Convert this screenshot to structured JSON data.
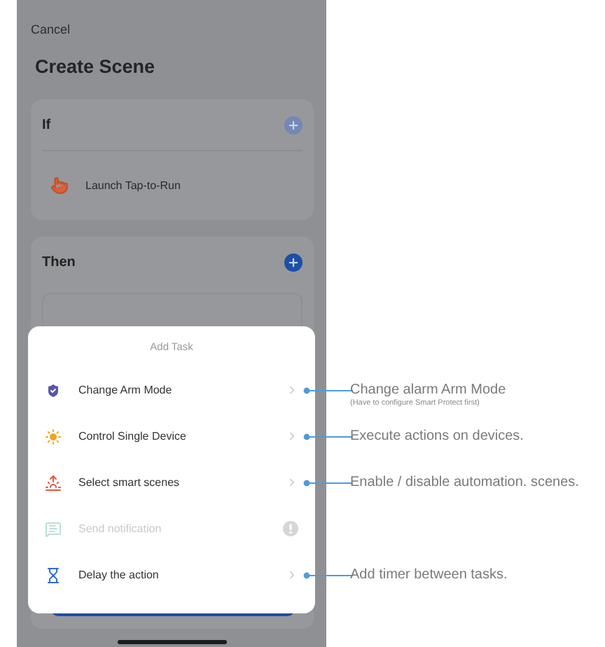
{
  "header": {
    "cancel": "Cancel",
    "title": "Create Scene"
  },
  "if_card": {
    "title": "If",
    "condition": "Launch Tap-to-Run"
  },
  "then_card": {
    "title": "Then"
  },
  "modal": {
    "title": "Add Task",
    "items": [
      {
        "kind": "shield",
        "label": "Change Arm Mode",
        "disabled": false,
        "annotation": {
          "text": "Change alarm Arm Mode",
          "note": "(Have to configure Smart Protect first)"
        }
      },
      {
        "kind": "sun",
        "label": "Control Single Device",
        "disabled": false,
        "annotation": {
          "text": "Execute actions on devices."
        }
      },
      {
        "kind": "sunrise",
        "label": "Select smart scenes",
        "disabled": false,
        "annotation": {
          "text": "Enable / disable automation. scenes."
        }
      },
      {
        "kind": "message",
        "label": "Send notification",
        "disabled": true
      },
      {
        "kind": "hourglass",
        "label": "Delay the action",
        "disabled": false,
        "annotation": {
          "text": "Add timer between tasks."
        }
      }
    ]
  }
}
